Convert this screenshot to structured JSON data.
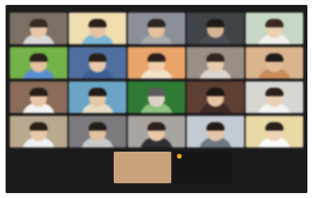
{
  "window": {
    "title": ""
  },
  "tiles": [
    {
      "bg": "#7c7064",
      "skin": "#e7c7a8",
      "hair": "#3a2a22",
      "shirt": "#d8d8d8"
    },
    {
      "bg": "#f0ddb0",
      "skin": "#e6c4a2",
      "hair": "#2a1f18",
      "shirt": "#7fb8d6"
    },
    {
      "bg": "#8b8f98",
      "skin": "#e2c0a0",
      "hair": "#2f2520",
      "shirt": "#a9a9a9"
    },
    {
      "bg": "#3f4448",
      "skin": "#d8b393",
      "hair": "#1e1a17",
      "shirt": "#4a4f55"
    },
    {
      "bg": "#c7d7c5",
      "skin": "#ecd0b0",
      "hair": "#3b2a1f",
      "shirt": "#f0f0ee"
    },
    {
      "bg": "#74b24a",
      "skin": "#e5c19c",
      "hair": "#2a211c",
      "shirt": "#5a8fd0"
    },
    {
      "bg": "#4f6fa0",
      "skin": "#e9c8a8",
      "hair": "#2b2019",
      "shirt": "#3b5f95"
    },
    {
      "bg": "#e9a46a",
      "skin": "#f0cfae",
      "hair": "#2d2018",
      "shirt": "#f1e2c9"
    },
    {
      "bg": "#9a8f86",
      "skin": "#eacbad",
      "hair": "#33261d",
      "shirt": "#d9d4cf"
    },
    {
      "bg": "#d9b48c",
      "skin": "#e0bc97",
      "hair": "#1f1a17",
      "shirt": "#c88b5a"
    },
    {
      "bg": "#8a6c58",
      "skin": "#e6c6a6",
      "hair": "#2a1e18",
      "shirt": "#f3f3f3"
    },
    {
      "bg": "#6aa5c8",
      "skin": "#e8c7a6",
      "hair": "#241c17",
      "shirt": "#e9dcc4"
    },
    {
      "bg": "#2f7b35",
      "skin": "#ddd2c6",
      "hair": "#5a5a5a",
      "shirt": "#8ec07f"
    },
    {
      "bg": "#5e3f34",
      "skin": "#e7c3a2",
      "hair": "#1d1714",
      "shirt": "#3d2b24"
    },
    {
      "bg": "#d8d6d3",
      "skin": "#ecd0b3",
      "hair": "#2b211b",
      "shirt": "#f4f4f4"
    },
    {
      "bg": "#b9aa8f",
      "skin": "#e8c8a7",
      "hair": "#2b2019",
      "shirt": "#eef1f4"
    },
    {
      "bg": "#7d7a7e",
      "skin": "#e2c1a0",
      "hair": "#251c17",
      "shirt": "#c9c9cc"
    },
    {
      "bg": "#a8a49f",
      "skin": "#e9c8a8",
      "hair": "#2c211a",
      "shirt": "#2f2f33"
    },
    {
      "bg": "#c5cbd3",
      "skin": "#e6c5a6",
      "hair": "#231b16",
      "shirt": "#6f7784"
    },
    {
      "bg": "#e8d9a5",
      "skin": "#f0d3b7",
      "hair": "#2a1f19",
      "shirt": "#fbfbfb"
    }
  ],
  "bottom_tiles": [
    {
      "bg": "#c9a27a",
      "skin": "#e9c7a5",
      "hair": "#2a1f18",
      "shirt": "#ededed",
      "name": ""
    },
    {
      "bg": "#151515",
      "label": ""
    }
  ]
}
